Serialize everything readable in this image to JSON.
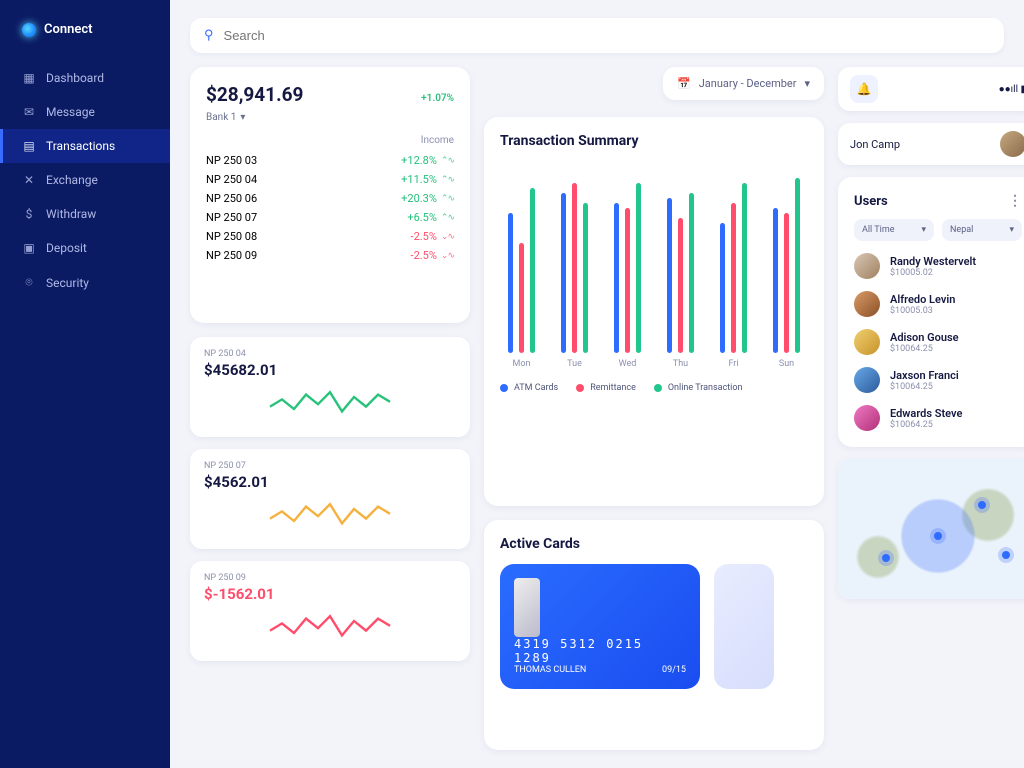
{
  "app": {
    "name": "Connect"
  },
  "sidebar": {
    "items": [
      {
        "label": "Dashboard",
        "icon": "▦"
      },
      {
        "label": "Message",
        "icon": "✉"
      },
      {
        "label": "Transactions",
        "icon": "▤",
        "active": true
      },
      {
        "label": "Exchange",
        "icon": "✕"
      },
      {
        "label": "Withdraw",
        "icon": "$"
      },
      {
        "label": "Deposit",
        "icon": "▣"
      },
      {
        "label": "Security",
        "icon": "⌾"
      }
    ]
  },
  "search": {
    "placeholder": "Search"
  },
  "balance": {
    "amount": "$28,941.69",
    "change": "+1.07%",
    "bank_label": "Bank 1",
    "income_header": "Income",
    "banks": [
      {
        "name": "NP 250 03",
        "pct": "+12.8%",
        "dir": "up"
      },
      {
        "name": "NP 250 04",
        "pct": "+11.5%",
        "dir": "up"
      },
      {
        "name": "NP 250 06",
        "pct": "+20.3%",
        "dir": "up"
      },
      {
        "name": "NP 250 07",
        "pct": "+6.5%",
        "dir": "up"
      },
      {
        "name": "NP 250 08",
        "pct": "-2.5%",
        "dir": "down"
      },
      {
        "name": "NP 250 09",
        "pct": "-2.5%",
        "dir": "down"
      }
    ]
  },
  "sparklines": [
    {
      "label": "NP 250 04",
      "amount": "$45682.01",
      "color": "#29c27a"
    },
    {
      "label": "NP 250 07",
      "amount": "$4562.01",
      "color": "#f5b13d"
    },
    {
      "label": "NP 250 09",
      "amount": "$-1562.01",
      "color": "#ff4d6b",
      "negative": true
    }
  ],
  "date_range": "January - December",
  "chart_data": {
    "type": "bar",
    "title": "Transaction Summary",
    "categories": [
      "Mon",
      "Tue",
      "Wed",
      "Thu",
      "Fri",
      "Sun"
    ],
    "series": [
      {
        "name": "ATM Cards",
        "color": "#2e6bff",
        "values": [
          140,
          160,
          150,
          155,
          130,
          145
        ]
      },
      {
        "name": "Remittance",
        "color": "#ff4d6b",
        "values": [
          110,
          170,
          145,
          135,
          150,
          140
        ]
      },
      {
        "name": "Online Transaction",
        "color": "#22c58c",
        "values": [
          165,
          150,
          170,
          160,
          170,
          175
        ]
      }
    ],
    "ylim": [
      0,
      180
    ]
  },
  "active_cards": {
    "title": "Active Cards",
    "card": {
      "number": "4319  5312  0215  1289",
      "name": "THOMAS CULLEN",
      "expiry": "09/15"
    }
  },
  "profile": {
    "name": "Jon Camp"
  },
  "users": {
    "title": "Users",
    "filters": {
      "time": "All Time",
      "region": "Nepal"
    },
    "list": [
      {
        "name": "Randy Westervelt",
        "amount": "$10005.02"
      },
      {
        "name": "Alfredo Levin",
        "amount": "$10005.03"
      },
      {
        "name": "Adison Gouse",
        "amount": "$10064.25"
      },
      {
        "name": "Jaxson Franci",
        "amount": "$10064.25"
      },
      {
        "name": "Edwards Steve",
        "amount": "$10064.25"
      }
    ]
  }
}
